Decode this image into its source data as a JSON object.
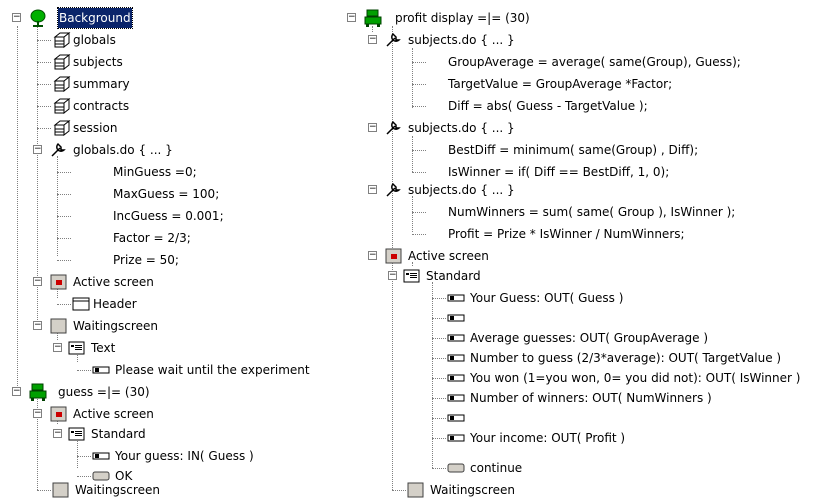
{
  "left": {
    "root": "Background",
    "globals": "globals",
    "subjects": "subjects",
    "summary": "summary",
    "contracts": "contracts",
    "session": "session",
    "globals_do": "globals.do { ... }",
    "lines": [
      "MinGuess =0;",
      "MaxGuess = 100;",
      "IncGuess = 0.001;",
      "Factor = 2/3;",
      "Prize = 50;"
    ],
    "active_screen": "Active screen",
    "header": "Header",
    "waiting": "Waitingscreen",
    "text_box": "Text",
    "wait_text": "Please wait until the experiment",
    "guess_stage": "guess =|= (30)",
    "guess_active": "Active screen",
    "standard": "Standard",
    "your_guess": "Your guess: IN( Guess )",
    "ok": "OK",
    "guess_waiting": "Waitingscreen"
  },
  "right": {
    "stage": "profit display =|= (30)",
    "sub1": "subjects.do { ... }",
    "sub1_lines": [
      "GroupAverage = average( same(Group), Guess);",
      "TargetValue = GroupAverage *Factor;",
      "Diff = abs( Guess - TargetValue );"
    ],
    "sub2": "subjects.do { ... }",
    "sub2_lines": [
      "BestDiff = minimum( same(Group) , Diff);",
      "IsWinner = if( Diff == BestDiff, 1, 0);"
    ],
    "sub3": "subjects.do { ... }",
    "sub3_lines": [
      "NumWinners = sum( same( Group ), IsWinner );",
      "Profit = Prize * IsWinner / NumWinners;"
    ],
    "active_screen": "Active screen",
    "standard": "Standard",
    "items": [
      "Your Guess: OUT( Guess )",
      "",
      "Average guesses: OUT( GroupAverage )",
      "Number to guess (2/3*average): OUT( TargetValue )",
      "You won (1=you won, 0= you did not): OUT( IsWinner )",
      "Number of winners: OUT( NumWinners )",
      "",
      "Your income: OUT( Profit )"
    ],
    "continue": "continue",
    "waiting": "Waitingscreen"
  },
  "colors": {
    "selection": "#0a246a",
    "stage_green": "#00a000",
    "screen_red": "#cc0000",
    "tree_line": "#808080"
  }
}
